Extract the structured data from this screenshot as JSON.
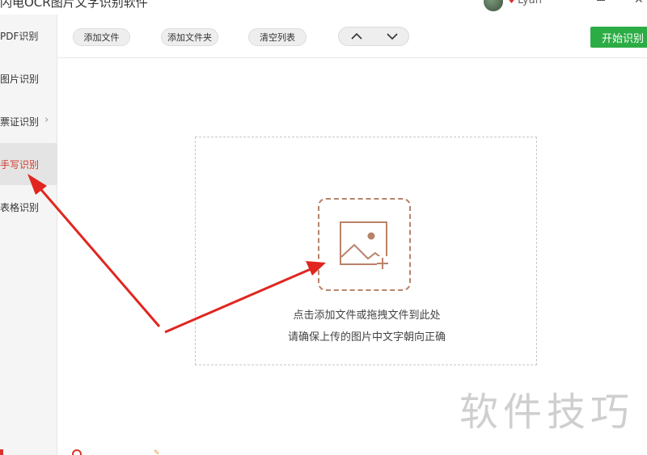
{
  "window": {
    "title": "闪电OCR图片文字识别软件",
    "username": "Lyan",
    "vip_mark": "♥",
    "minimize_icon": "minimize-icon",
    "close_icon": "close-icon",
    "close_glyph": "✕"
  },
  "sidebar": {
    "items": [
      {
        "label": "PDF识别",
        "active": false
      },
      {
        "label": "图片识别",
        "active": false
      },
      {
        "label": "票证识别",
        "active": false,
        "has_submenu": true
      },
      {
        "label": "手写识别",
        "active": true
      },
      {
        "label": "表格识别",
        "active": false
      }
    ],
    "chevron_glyph": "›"
  },
  "toolbar": {
    "add_file_label": "添加文件",
    "add_folder_label": "添加文件夹",
    "clear_list_label": "清空列表",
    "move_up_icon": "chevron-up-icon",
    "move_down_icon": "chevron-down-icon",
    "start_label": "开始识别"
  },
  "dropzone": {
    "icon": "add-image-icon",
    "line1": "点击添加文件或拖拽文件到此处",
    "line2": "请确保上传的图片中文字朝向正确"
  },
  "watermark": {
    "text": "软件技巧"
  },
  "colors": {
    "accent_green": "#2cac45",
    "active_red": "#d33a2c",
    "icon_brown": "#b9826a",
    "annotation_red": "#e0261f"
  }
}
